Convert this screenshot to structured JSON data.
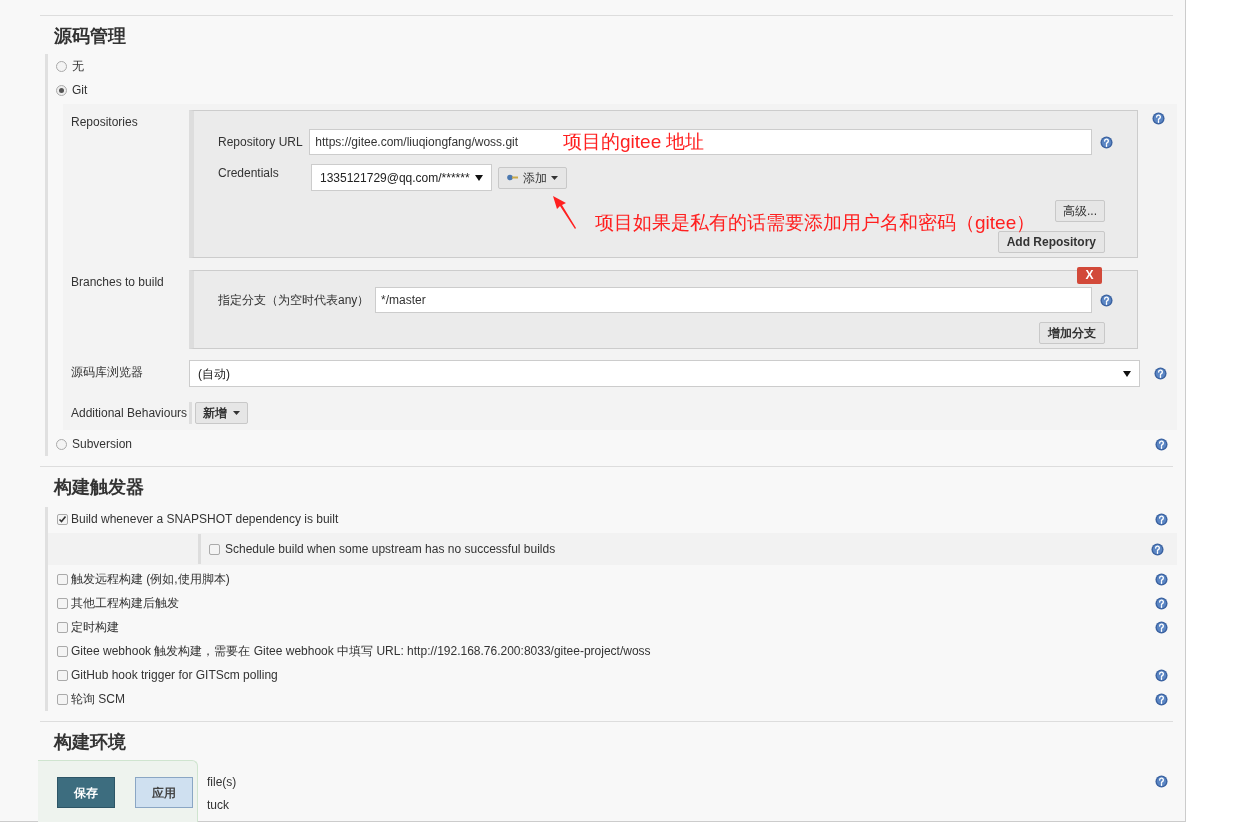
{
  "scm": {
    "title": "源码管理",
    "options": [
      {
        "label": "无",
        "selected": false,
        "help": false
      },
      {
        "label": "Git",
        "selected": true,
        "help": false
      },
      {
        "label": "Subversion",
        "selected": false,
        "help": true
      }
    ],
    "git": {
      "repositories_label": "Repositories",
      "repository_url_label": "Repository URL",
      "repository_url": "https://gitee.com/liuqiongfang/woss.git",
      "credentials_label": "Credentials",
      "credentials": "1335121729@qq.com/******",
      "add_button": "添加",
      "advanced_button": "高级...",
      "add_repository_button": "Add Repository",
      "branches_label": "Branches to build",
      "branch_specifier_label": "指定分支（为空时代表any）",
      "branch_specifier": "*/master",
      "delete_button": "X",
      "add_branch_button": "增加分支",
      "browser_label": "源码库浏览器",
      "browser": "(自动)",
      "behaviours_label": "Additional Behaviours",
      "behaviours_button": "新增"
    }
  },
  "annotations": [
    {
      "text": "项目的gitee 地址"
    },
    {
      "text": "项目如果是私有的话需要添加用户名和密码（gitee）"
    }
  ],
  "triggers": {
    "title": "构建触发器",
    "items": [
      {
        "label": "Build whenever a SNAPSHOT dependency is built",
        "checked": true,
        "help": true,
        "children": [
          {
            "label": "Schedule build when some upstream has no successful builds",
            "checked": false,
            "help": true
          }
        ]
      },
      {
        "label": "触发远程构建 (例如,使用脚本)",
        "checked": false,
        "help": true
      },
      {
        "label": "其他工程构建后触发",
        "checked": false,
        "help": true
      },
      {
        "label": "定时构建",
        "checked": false,
        "help": true
      },
      {
        "label": "Gitee webhook 触发构建，需要在 Gitee webhook 中填写 URL: http://192.168.76.200:8033/gitee-project/woss",
        "checked": false,
        "help": false
      },
      {
        "label": "GitHub hook trigger for GITScm polling",
        "checked": false,
        "help": true
      },
      {
        "label": "轮询 SCM",
        "checked": false,
        "help": true
      }
    ]
  },
  "environment": {
    "title": "构建环境",
    "items": [
      {
        "label": "file(s)",
        "help": true
      },
      {
        "label": "tuck",
        "help": false
      }
    ]
  },
  "footer": {
    "buttons": [
      {
        "label": "保存",
        "kind": "primary"
      },
      {
        "label": "应用",
        "kind": "secondary"
      }
    ]
  }
}
